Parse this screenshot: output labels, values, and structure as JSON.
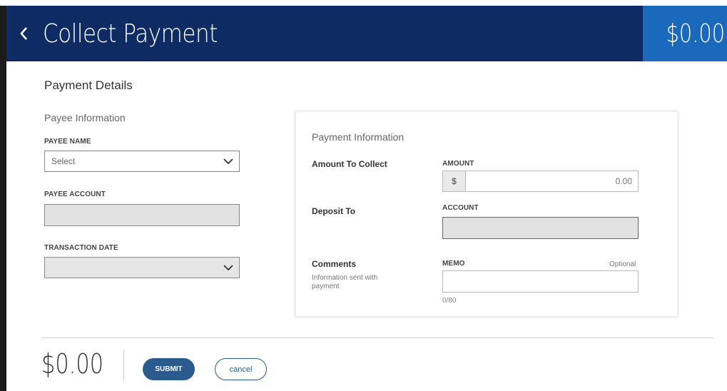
{
  "header": {
    "title": "Collect Payment",
    "amount": "$0.00",
    "back_icon": "chevron-left-icon"
  },
  "payment_details": {
    "title": "Payment Details",
    "payee_section": {
      "title": "Payee Information",
      "payee_name_label": "PAYEE NAME",
      "payee_name_value": "Select",
      "payee_account_label": "PAYEE ACCOUNT",
      "transaction_date_label": "TRANSACTION DATE"
    },
    "payment_info": {
      "title": "Payment Information",
      "amount_row_label": "Amount To Collect",
      "amount_field_label": "AMOUNT",
      "currency_prefix": "$",
      "amount_placeholder": "0.00",
      "deposit_row_label": "Deposit To",
      "account_field_label": "ACCOUNT",
      "comments_row_label": "Comments",
      "comments_help": "Information sent with payment",
      "memo_field_label": "MEMO",
      "memo_optional": "Optional",
      "memo_counter": "0/80"
    }
  },
  "footer": {
    "amount": "$0.00",
    "submit_label": "SUBMIT",
    "cancel_label": "cancel"
  },
  "colors": {
    "header_bg": "#0e2c63",
    "header_amount_bg": "#1a69bd",
    "primary_button": "#2a5a8e"
  }
}
